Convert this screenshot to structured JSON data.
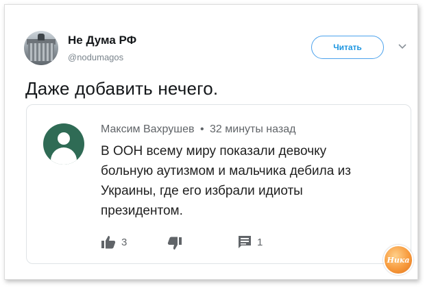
{
  "tweet": {
    "account_name": "Не Дума РФ",
    "handle": "@nodumagos",
    "follow_label": "Читать",
    "text": "Даже добавить нечего."
  },
  "quoted_comment": {
    "author": "Максим Вахрушев",
    "separator": "•",
    "time": "32 минуты назад",
    "text": "В ООН всему миру показали девочку\nбольную аутизмом и мальчика  дебила из\nУкраины, где его избрали идиоты\nпрезидентом.",
    "likes": "3",
    "replies": "1"
  },
  "icons": {
    "chevron": "chevron-down-icon",
    "like": "thumbs-up-icon",
    "dislike": "thumbs-down-icon",
    "reply": "comment-icon"
  },
  "colors": {
    "accent": "#1b95e0",
    "avatar_bg": "#2f6b55",
    "logo": "#f79a3c"
  },
  "watermark": {
    "text": "Ника"
  }
}
